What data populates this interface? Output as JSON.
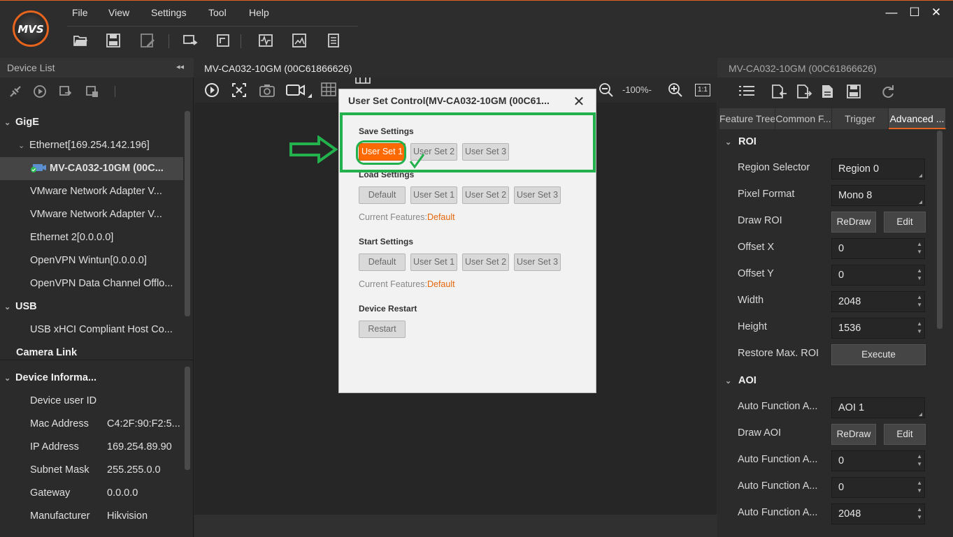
{
  "app": {
    "logo_text": "MVS",
    "accent": "#e5641e"
  },
  "menu": [
    "File",
    "View",
    "Settings",
    "Tool",
    "Help"
  ],
  "window_controls": {
    "minimize": "—",
    "maximize": "☐",
    "close": "✕"
  },
  "left_panel": {
    "title": "Device List",
    "collapse": "◂◂",
    "tree": [
      {
        "label": "GigE",
        "type": "group"
      },
      {
        "label": "Ethernet[169.254.142.196]",
        "type": "sub"
      },
      {
        "label": "MV-CA032-10GM (00C...",
        "type": "device"
      },
      {
        "label": "VMware Network Adapter V...",
        "type": "item"
      },
      {
        "label": "VMware Network Adapter V...",
        "type": "item"
      },
      {
        "label": "Ethernet 2[0.0.0.0]",
        "type": "item"
      },
      {
        "label": "OpenVPN Wintun[0.0.0.0]",
        "type": "item"
      },
      {
        "label": "OpenVPN Data Channel Offlo...",
        "type": "item"
      },
      {
        "label": "USB",
        "type": "group"
      },
      {
        "label": "USB xHCI Compliant Host Co...",
        "type": "item"
      },
      {
        "label": "Camera Link",
        "type": "group"
      }
    ],
    "info_title": "Device Informa...",
    "info": [
      {
        "label": "Device user ID",
        "value": ""
      },
      {
        "label": "Mac Address",
        "value": "C4:2F:90:F2:5..."
      },
      {
        "label": "IP Address",
        "value": "169.254.89.90"
      },
      {
        "label": "Subnet Mask",
        "value": "255.255.0.0"
      },
      {
        "label": "Gateway",
        "value": "0.0.0.0"
      },
      {
        "label": "Manufacturer",
        "value": "Hikvision"
      }
    ]
  },
  "center": {
    "tab_title": "MV-CA032-10GM (00C61866626)",
    "zoom": "-100%-",
    "one_to_one": "1:1"
  },
  "dialog": {
    "title": "User Set Control(MV-CA032-10GM (00C61...",
    "close": "✕",
    "save": {
      "title": "Save Settings",
      "buttons": [
        "User Set 1",
        "User Set 2",
        "User Set 3"
      ]
    },
    "load": {
      "title": "Load Settings",
      "buttons": [
        "Default",
        "User Set 1",
        "User Set 2",
        "User Set 3"
      ],
      "current_label": "Current Features:",
      "current_value": "Default"
    },
    "start": {
      "title": "Start Settings",
      "buttons": [
        "Default",
        "User Set 1",
        "User Set 2",
        "User Set 3"
      ],
      "current_label": "Current Features:",
      "current_value": "Default"
    },
    "restart": {
      "title": "Device Restart",
      "button": "Restart"
    },
    "annotation_color": "#22b14c"
  },
  "right_panel": {
    "title": "MV-CA032-10GM (00C61866626)",
    "tabs": [
      "Feature Tree",
      "Common F...",
      "Trigger",
      "Advanced ..."
    ],
    "groups": [
      {
        "name": "ROI",
        "props": [
          {
            "label": "Region Selector",
            "kind": "combo",
            "value": "Region 0"
          },
          {
            "label": "Pixel Format",
            "kind": "combo",
            "value": "Mono 8"
          },
          {
            "label": "Draw ROI",
            "kind": "buttons",
            "b1": "ReDraw",
            "b2": "Edit"
          },
          {
            "label": "Offset X",
            "kind": "spin",
            "value": "0"
          },
          {
            "label": "Offset Y",
            "kind": "spin",
            "value": "0"
          },
          {
            "label": "Width",
            "kind": "spin",
            "value": "2048"
          },
          {
            "label": "Height",
            "kind": "spin",
            "value": "1536"
          },
          {
            "label": "Restore Max. ROI",
            "kind": "exec",
            "b1": "Execute"
          }
        ]
      },
      {
        "name": "AOI",
        "props": [
          {
            "label": "Auto Function A...",
            "kind": "combo",
            "value": "AOI 1"
          },
          {
            "label": "Draw AOI",
            "kind": "buttons",
            "b1": "ReDraw",
            "b2": "Edit"
          },
          {
            "label": "Auto Function A...",
            "kind": "spin",
            "value": "0"
          },
          {
            "label": "Auto Function A...",
            "kind": "spin",
            "value": "0"
          },
          {
            "label": "Auto Function A...",
            "kind": "spin",
            "value": "2048"
          }
        ]
      }
    ]
  }
}
